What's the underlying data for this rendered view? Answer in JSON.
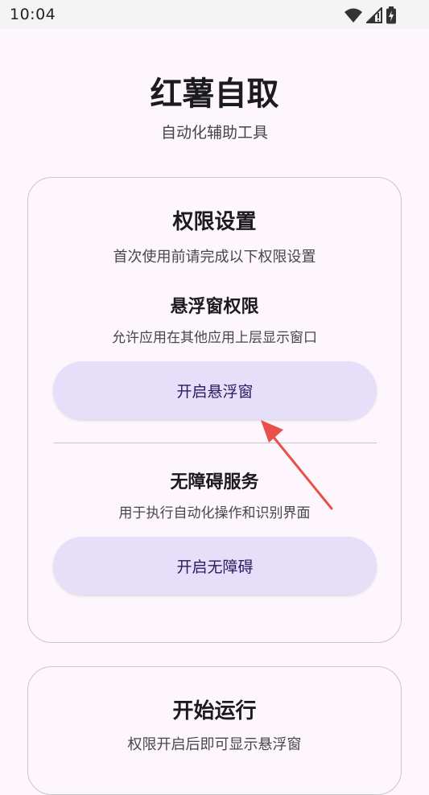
{
  "status_bar": {
    "time": "10:04",
    "icons": [
      "wifi-icon",
      "cellular-icon",
      "battery-charging-icon"
    ]
  },
  "header": {
    "title": "红薯自取",
    "subtitle": "自动化辅助工具"
  },
  "permissions_card": {
    "title": "权限设置",
    "description": "首次使用前请完成以下权限设置",
    "overlay": {
      "title": "悬浮窗权限",
      "description": "允许应用在其他应用上层显示窗口",
      "button_label": "开启悬浮窗"
    },
    "accessibility": {
      "title": "无障碍服务",
      "description": "用于执行自动化操作和识别界面",
      "button_label": "开启无障碍"
    }
  },
  "start_card": {
    "title": "开始运行",
    "description": "权限开启后即可显示悬浮窗"
  },
  "colors": {
    "background": "#fdf7fd",
    "button_fill": "#e6dffa",
    "button_text": "#2a1a5e",
    "card_border": "#c9c5cd",
    "annotation_arrow": "#e8504a"
  }
}
